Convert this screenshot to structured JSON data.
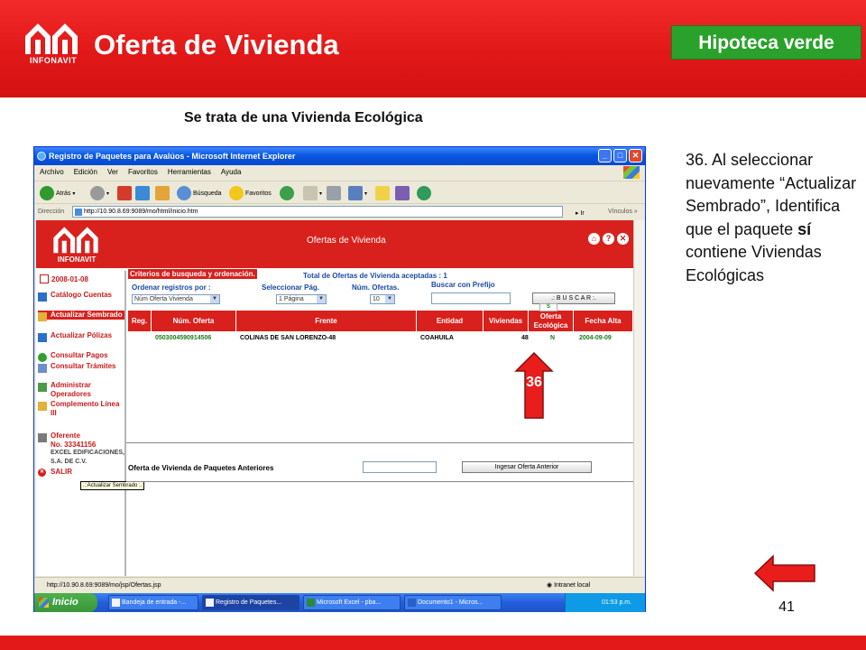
{
  "slide": {
    "title": "Oferta de Vivienda",
    "logo_text": "INFONAVIT",
    "badge": "Hipoteca verde",
    "subtitle": "Se trata de una Vivienda Ecológica",
    "note_1": "36. Al seleccionar nuevamente “Actualizar Sembrado”, Identifica que el paquete ",
    "note_bold": "sí",
    "note_2": " contiene Viviendas Ecológicas",
    "page_number": "41",
    "step_marker": "36",
    "colors": {
      "brand_red": "#e01818",
      "badge_green": "#2aa12a"
    }
  },
  "browser": {
    "window_title": "Registro de Paquetes para Avalúos - Microsoft Internet Explorer",
    "menu": [
      "Archivo",
      "Edición",
      "Ver",
      "Favoritos",
      "Herramientas",
      "Ayuda"
    ],
    "toolbar": {
      "back": "Atrás",
      "search": "Búsqueda",
      "favorites": "Favoritos"
    },
    "address_label": "Dirección",
    "address": "http://10.90.8.69:9089/mo/html/inicio.htm",
    "go": "Ir",
    "links": "Vínculos",
    "status_url": "http://10.90.8.69:9089/mo/jsp/Ofertas.jsp",
    "status_zone": "Intranet local"
  },
  "app": {
    "logo_text": "INFONAVIT",
    "header_title": "Ofertas de Vivienda",
    "date": "2008-01-08",
    "menu_items": [
      {
        "label": "Catálogo Cuentas"
      },
      {
        "label": "Actualizar Sembrado"
      },
      {
        "label": "Actualizar Pólizas"
      },
      {
        "label": "Consultar Pagos"
      },
      {
        "label": "Consultar Trámites"
      },
      {
        "label": "Administrar Operadores"
      },
      {
        "label": "Complemento Línea III"
      }
    ],
    "tooltip": ".: Actualizar Sembrado :.",
    "oferente_label": "Oferente",
    "oferente_no": "No. 33341156",
    "oferente_name": "EXCEL EDIFICACIONES, S.A. DE C.V.",
    "exit": "SALIR",
    "criteria_title": "Criterios de busqueda y ordenación.",
    "total_text": "Total de Ofertas de Vivienda aceptadas : 1",
    "order_label": "Ordenar registros por :",
    "order_value": "Núm Oferta Vivienda",
    "page_label": "Seleccionar Pág.",
    "page_value": "1 Página",
    "count_label": "Núm. Ofertas.",
    "count_value": "10",
    "prefix_label": "Buscar con Prefijo",
    "search_button": ".: B U S C A R :.",
    "s_marker": "S",
    "table": {
      "headers": [
        "Reg.",
        "Núm. Oferta",
        "Frente",
        "Entidad",
        "Viviendas",
        "Oferta Ecológica",
        "Fecha Alta"
      ],
      "rows": [
        [
          "",
          "0503004590914506",
          "COLINAS DE SAN LORENZO-48",
          "COAHUILA",
          "48",
          "N",
          "2004-09-09"
        ]
      ]
    },
    "prev_label": "Oferta de Vivienda de Paquetes Anteriores",
    "prev_button": "Ingesar Oferta Anterior"
  },
  "taskbar": {
    "start": "Inicio",
    "tasks": [
      "Bandeja de entrada -...",
      "Registro de Paquetes...",
      "Microsoft Excel - pba...",
      "Documento1 - Micros..."
    ],
    "clock": "01:53 p.m."
  }
}
